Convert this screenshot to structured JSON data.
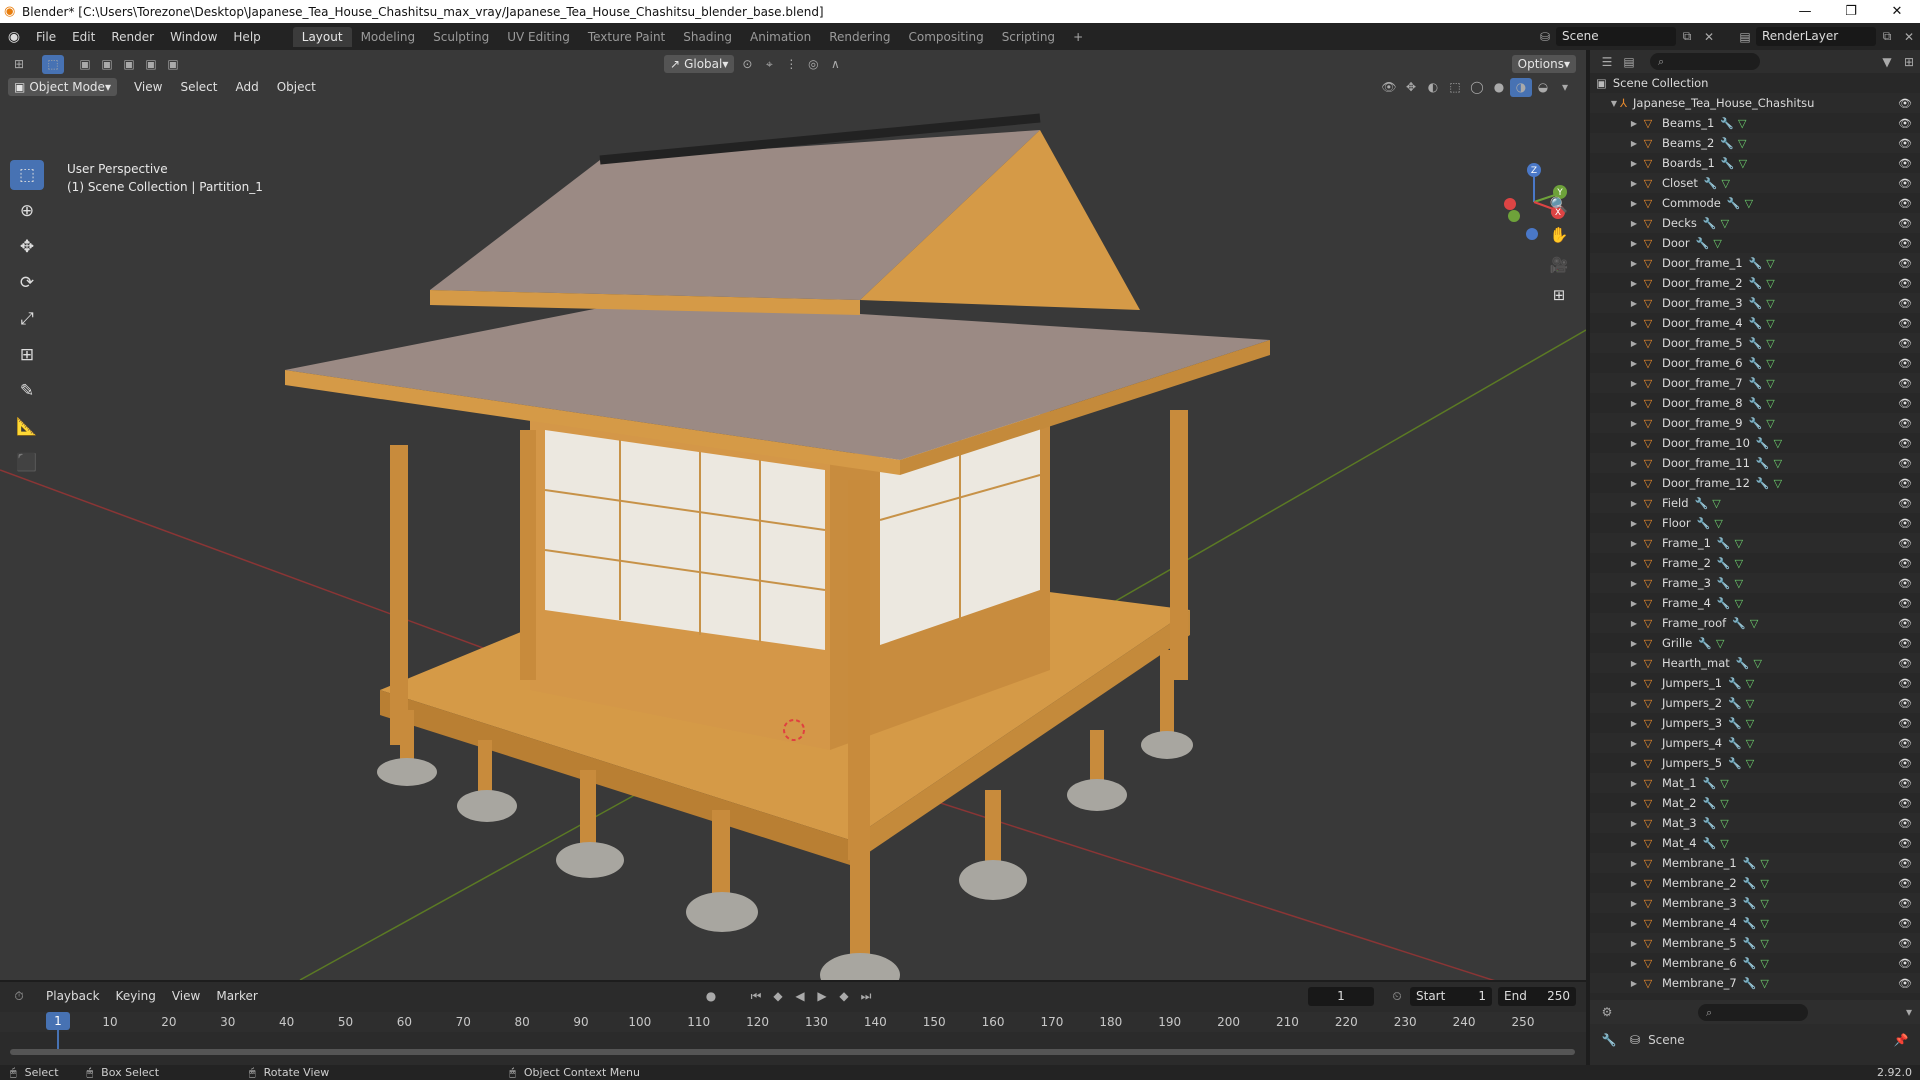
{
  "window": {
    "title": "Blender* [C:\\Users\\Torezone\\Desktop\\Japanese_Tea_House_Chashitsu_max_vray/Japanese_Tea_House_Chashitsu_blender_base.blend]"
  },
  "menu": [
    "File",
    "Edit",
    "Render",
    "Window",
    "Help"
  ],
  "workspaces": [
    "Layout",
    "Modeling",
    "Sculpting",
    "UV Editing",
    "Texture Paint",
    "Shading",
    "Animation",
    "Rendering",
    "Compositing",
    "Scripting"
  ],
  "workspace_active": "Layout",
  "scene": {
    "name": "Scene",
    "view_layer": "RenderLayer"
  },
  "viewport": {
    "mode": "Object Mode",
    "menus": [
      "View",
      "Select",
      "Add",
      "Object"
    ],
    "transform": "Global",
    "options": "Options",
    "info_line1": "User Perspective",
    "info_line2": "(1) Scene Collection | Partition_1",
    "colors": {
      "roof": "#9b8a84",
      "wood": "#d59a47",
      "shoji": "#ece8e0",
      "stone": "#a8a6a0",
      "background": "#393939",
      "axis_x": "#8a3535",
      "axis_y": "#5b7a24"
    },
    "gizmo": {
      "x": "X",
      "y": "Y",
      "z": "Z"
    }
  },
  "tools": [
    "select-box",
    "cursor",
    "move",
    "rotate",
    "scale",
    "transform",
    "annotate",
    "measure",
    "add-cube"
  ],
  "outliner": {
    "root": "Scene Collection",
    "collection": "Japanese_Tea_House_Chashitsu",
    "items": [
      "Beams_1",
      "Beams_2",
      "Boards_1",
      "Closet",
      "Commode",
      "Decks",
      "Door",
      "Door_frame_1",
      "Door_frame_2",
      "Door_frame_3",
      "Door_frame_4",
      "Door_frame_5",
      "Door_frame_6",
      "Door_frame_7",
      "Door_frame_8",
      "Door_frame_9",
      "Door_frame_10",
      "Door_frame_11",
      "Door_frame_12",
      "Field",
      "Floor",
      "Frame_1",
      "Frame_2",
      "Frame_3",
      "Frame_4",
      "Frame_roof",
      "Grille",
      "Hearth_mat",
      "Jumpers_1",
      "Jumpers_2",
      "Jumpers_3",
      "Jumpers_4",
      "Jumpers_5",
      "Mat_1",
      "Mat_2",
      "Mat_3",
      "Mat_4",
      "Membrane_1",
      "Membrane_2",
      "Membrane_3",
      "Membrane_4",
      "Membrane_5",
      "Membrane_6",
      "Membrane_7"
    ]
  },
  "properties": {
    "scene_label": "Scene"
  },
  "timeline": {
    "menus": [
      "Playback",
      "Keying",
      "View",
      "Marker"
    ],
    "current_frame": "1",
    "start_label": "Start",
    "start": "1",
    "end_label": "End",
    "end": "250",
    "ticks": [
      "1",
      "10",
      "20",
      "30",
      "40",
      "50",
      "60",
      "70",
      "80",
      "90",
      "100",
      "110",
      "120",
      "130",
      "140",
      "150",
      "160",
      "170",
      "180",
      "190",
      "200",
      "210",
      "220",
      "230",
      "240",
      "250"
    ]
  },
  "status": {
    "select": "Select",
    "box_select": "Box Select",
    "rotate_view": "Rotate View",
    "context_menu": "Object Context Menu",
    "version": "2.92.0"
  }
}
